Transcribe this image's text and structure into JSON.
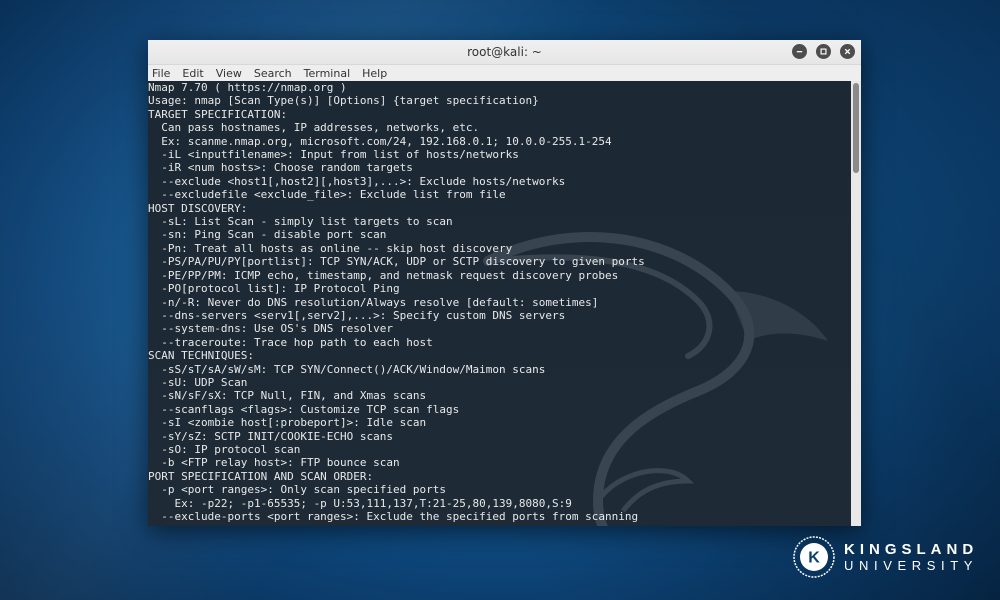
{
  "window": {
    "title": "root@kali: ~",
    "menus": [
      "File",
      "Edit",
      "View",
      "Search",
      "Terminal",
      "Help"
    ]
  },
  "terminal": {
    "lines": [
      "Nmap 7.70 ( https://nmap.org )",
      "Usage: nmap [Scan Type(s)] [Options] {target specification}",
      "TARGET SPECIFICATION:",
      "  Can pass hostnames, IP addresses, networks, etc.",
      "  Ex: scanme.nmap.org, microsoft.com/24, 192.168.0.1; 10.0.0-255.1-254",
      "  -iL <inputfilename>: Input from list of hosts/networks",
      "  -iR <num hosts>: Choose random targets",
      "  --exclude <host1[,host2][,host3],...>: Exclude hosts/networks",
      "  --excludefile <exclude_file>: Exclude list from file",
      "HOST DISCOVERY:",
      "  -sL: List Scan - simply list targets to scan",
      "  -sn: Ping Scan - disable port scan",
      "  -Pn: Treat all hosts as online -- skip host discovery",
      "  -PS/PA/PU/PY[portlist]: TCP SYN/ACK, UDP or SCTP discovery to given ports",
      "  -PE/PP/PM: ICMP echo, timestamp, and netmask request discovery probes",
      "  -PO[protocol list]: IP Protocol Ping",
      "  -n/-R: Never do DNS resolution/Always resolve [default: sometimes]",
      "  --dns-servers <serv1[,serv2],...>: Specify custom DNS servers",
      "  --system-dns: Use OS's DNS resolver",
      "  --traceroute: Trace hop path to each host",
      "SCAN TECHNIQUES:",
      "  -sS/sT/sA/sW/sM: TCP SYN/Connect()/ACK/Window/Maimon scans",
      "  -sU: UDP Scan",
      "  -sN/sF/sX: TCP Null, FIN, and Xmas scans",
      "  --scanflags <flags>: Customize TCP scan flags",
      "  -sI <zombie host[:probeport]>: Idle scan",
      "  -sY/sZ: SCTP INIT/COOKIE-ECHO scans",
      "  -sO: IP protocol scan",
      "  -b <FTP relay host>: FTP bounce scan",
      "PORT SPECIFICATION AND SCAN ORDER:",
      "  -p <port ranges>: Only scan specified ports",
      "    Ex: -p22; -p1-65535; -p U:53,111,137,T:21-25,80,139,8080,S:9",
      "  --exclude-ports <port ranges>: Exclude the specified ports from scanning"
    ]
  },
  "branding": {
    "logo_letter": "K",
    "line1": "KINGSLAND",
    "line2": "UNIVERSITY"
  }
}
